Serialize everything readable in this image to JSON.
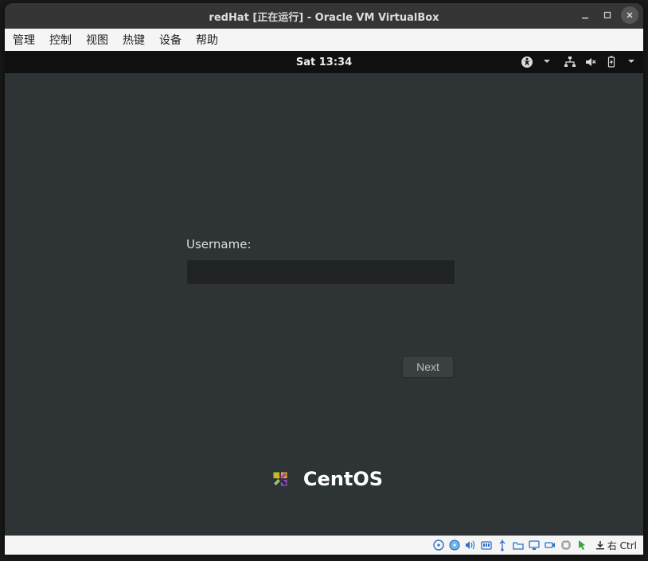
{
  "vbox": {
    "title": "redHat [正在运行] - Oracle VM VirtualBox",
    "menubar": [
      "管理",
      "控制",
      "视图",
      "热键",
      "设备",
      "帮助"
    ],
    "hostkey_label": "右 Ctrl"
  },
  "gnome": {
    "clock": "Sat 13:34"
  },
  "login": {
    "username_label": "Username:",
    "username_value": "",
    "next_label": "Next"
  },
  "brand": {
    "name": "CentOS"
  }
}
